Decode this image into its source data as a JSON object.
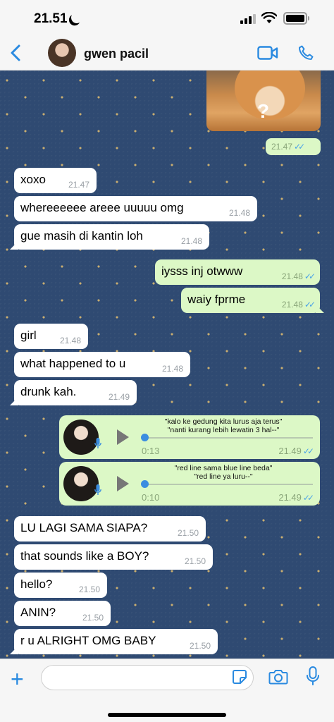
{
  "status": {
    "time": "21.51"
  },
  "header": {
    "contact_name": "gwen pacil"
  },
  "sticker": {
    "overlay": "?",
    "time": "21.47"
  },
  "messages": [
    {
      "text": "xoxo",
      "time": "21.47"
    },
    {
      "text": "whereeeeee areee uuuuu omg",
      "time": "21.48"
    },
    {
      "text": "gue masih di kantin loh",
      "time": "21.48"
    },
    {
      "text": "iysss inj otwww",
      "time": "21.48"
    },
    {
      "text": "waiy fprme",
      "time": "21.48"
    },
    {
      "text": "girl",
      "time": "21.48"
    },
    {
      "text": "what happened to u",
      "time": "21.48"
    },
    {
      "text": "drunk kah.",
      "time": "21.49"
    },
    {
      "text": "LU LAGI SAMA SIAPA?",
      "time": "21.50"
    },
    {
      "text": "that sounds like a BOY?",
      "time": "21.50"
    },
    {
      "text": "hello?",
      "time": "21.50"
    },
    {
      "text": "ANIN?",
      "time": "21.50"
    },
    {
      "text": "r u ALRIGHT OMG BABY",
      "time": "21.50"
    }
  ],
  "voice_notes": [
    {
      "caption_1": "\"kalo ke gedung kita lurus aja terus\"",
      "caption_2": "\"nanti kurang lebih lewatin 3 hal--\"",
      "duration": "0:13",
      "time": "21.49"
    },
    {
      "caption_1": "\"red line sama blue line beda\"",
      "caption_2": "\"red line ya luru--\"",
      "duration": "0:10",
      "time": "21.49"
    }
  ],
  "compose": {
    "value": ""
  },
  "colors": {
    "accent": "#2a8ae0",
    "outgoing_bubble": "#dcf8c6",
    "incoming_bubble": "#ffffff",
    "wallpaper": "#2f4a72",
    "read_ticks": "#4aa3e8"
  }
}
